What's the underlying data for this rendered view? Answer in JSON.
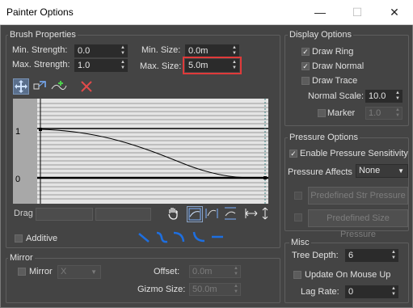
{
  "window": {
    "title": "Painter Options",
    "minimize_glyph": "—",
    "maximize_glyph": "☐",
    "close_glyph": "✕"
  },
  "brush": {
    "group_label": "Brush Properties",
    "min_strength_label": "Min. Strength:",
    "min_strength_value": "0.0",
    "max_strength_label": "Max. Strength:",
    "max_strength_value": "1.0",
    "min_size_label": "Min. Size:",
    "min_size_value": "0.0m",
    "max_size_label": "Max. Size:",
    "max_size_value": "5.0m",
    "curve_label_1": "1",
    "curve_label_0": "0",
    "drag_label": "Drag",
    "additive_label": "Additive"
  },
  "mirror": {
    "group_label": "Mirror",
    "mirror_label": "Mirror",
    "axis_value": "X",
    "offset_label": "Offset:",
    "offset_value": "0.0m",
    "gizmo_label": "Gizmo Size:",
    "gizmo_value": "50.0m"
  },
  "display": {
    "group_label": "Display Options",
    "draw_ring": "Draw Ring",
    "draw_normal": "Draw Normal",
    "draw_trace": "Draw Trace",
    "normal_scale_label": "Normal Scale:",
    "normal_scale_value": "10.0",
    "marker_label": "Marker",
    "marker_value": "1.0"
  },
  "pressure": {
    "group_label": "Pressure Options",
    "enable_label": "Enable Pressure Sensitivity",
    "affects_label": "Pressure Affects",
    "affects_value": "None",
    "predefined_str": "Predefined Str Pressure",
    "predefined_size": "Predefined Size Pressure"
  },
  "misc": {
    "group_label": "Misc",
    "tree_depth_label": "Tree Depth:",
    "tree_depth_value": "6",
    "update_label": "Update On Mouse Up",
    "lag_rate_label": "Lag Rate:",
    "lag_rate_value": "0"
  },
  "glyphs": {
    "check": "✓",
    "spin_up": "▲",
    "spin_down": "▼",
    "caret": "▼"
  },
  "colors": {
    "highlight_border": "#e03a3a",
    "icon_blue": "#6aaaf5",
    "background": "#444444"
  }
}
